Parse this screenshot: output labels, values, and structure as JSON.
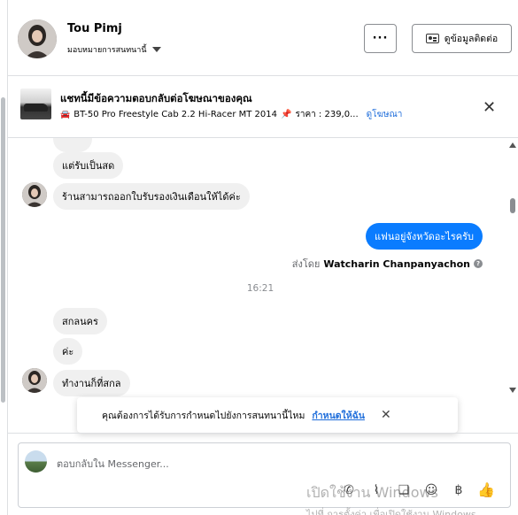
{
  "header": {
    "name": "Tou Pimj",
    "assign_label": "มอบหมายการสนทนานี้",
    "more_label": "···",
    "contact_button": "ดูข้อมูลติดต่อ"
  },
  "ad_banner": {
    "title": "แชทนี้มีข้อความตอบกลับต่อโฆษณาของคุณ",
    "product": "BT-50 Pro Freestyle Cab 2.2 Hi-Racer MT 2014",
    "price": "ราคา : 239,0...",
    "link": "ดูโฆษณา"
  },
  "messages": {
    "m1": "แต่รับเป็นสด",
    "m2": "ร้านสามารถออกใบรับรองเงินเดือนให้ได้ค่ะ",
    "m3_out": "แฟนอยู่จังหวัดอะไรครับ",
    "sent_by_prefix": "ส่งโดย",
    "sent_by_name": "Watcharin Chanpanyachon",
    "timestamp": "16:21",
    "m4": "สกลนคร",
    "m5": "ค่ะ",
    "m6": "ทำงานก็ที่สกล"
  },
  "toast": {
    "text": "คุณต้องการได้รับการกำหนดไปยังการสนทนานี้ไหม",
    "link": "กำหนดให้ฉัน"
  },
  "composer": {
    "placeholder": "ตอบกลับใน Messenger..."
  },
  "watermark": {
    "line1": "เปิดใช้งาน Windows",
    "line2": "ไปที่ การตั้งค่า เพื่อเปิดใช้งาน Windows"
  },
  "colors": {
    "accent": "#0a7cff",
    "link": "#216fdb",
    "bubble_in": "#f0f0f0"
  }
}
